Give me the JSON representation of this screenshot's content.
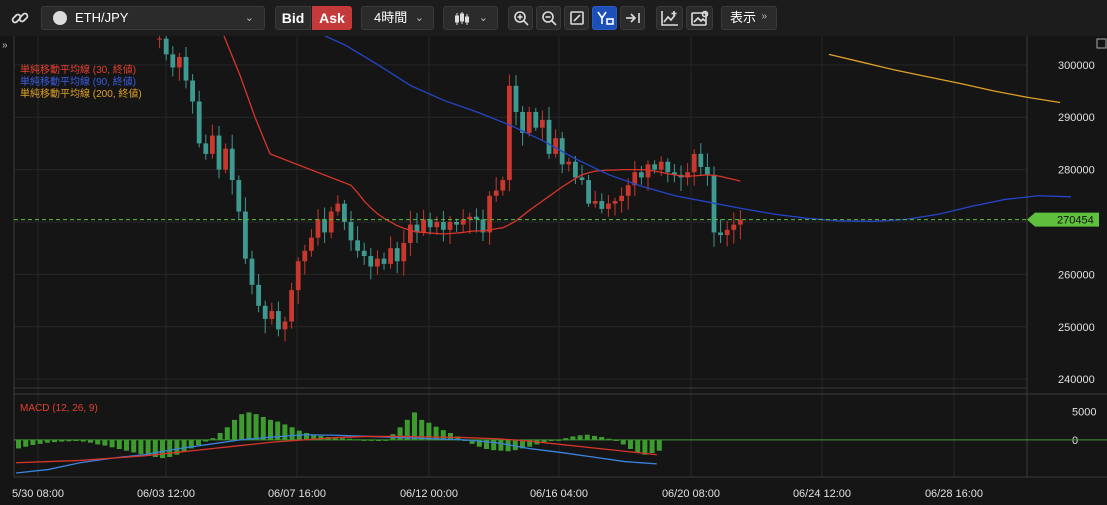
{
  "toolbar": {
    "symbol": "ETH/JPY",
    "bid_label": "Bid",
    "ask_label": "Ask",
    "timeframe": "4時間",
    "display_label": "表示"
  },
  "legend": {
    "ma30": "単純移動平均線 (30, 終値)",
    "ma90": "単純移動平均線 (90, 終値)",
    "ma200": "単純移動平均線 (200, 終値)",
    "macd": "MACD (12, 26, 9)"
  },
  "colors": {
    "up": "#c8382e",
    "down": "#3e9990",
    "ma30": "#d8352a",
    "ma90": "#2545c8",
    "ma200": "#e0a028",
    "macd_line": "#3a84e0",
    "signal_line": "#d8352a",
    "hist": "#3d9b2f",
    "price_tag": "#5ec03c"
  },
  "chart_data": [
    {
      "type": "candlestick",
      "symbol": "ETH/JPY",
      "interval": "4時間",
      "ylim": [
        238500,
        305500
      ],
      "yticks": [
        240000,
        250000,
        260000,
        270000,
        280000,
        290000,
        300000
      ],
      "xtick_labels": [
        "5/30 08:00",
        "06/03 12:00",
        "06/07 16:00",
        "06/12 00:00",
        "06/16 04:00",
        "06/20 08:00",
        "06/24 12:00",
        "06/28 16:00"
      ],
      "current_price": 270454,
      "current_price_label": "270454",
      "closes": [
        305000,
        305000,
        302000,
        299500,
        301500,
        297000,
        293000,
        285000,
        283000,
        286500,
        280000,
        284000,
        278000,
        272000,
        263000,
        258000,
        254000,
        251500,
        253000,
        249500,
        251000,
        257000,
        262500,
        264500,
        267000,
        270500,
        268000,
        272000,
        273500,
        270000,
        266500,
        264500,
        263500,
        261500,
        263000,
        262000,
        265000,
        262500,
        266000,
        269500,
        268000,
        270500,
        269000,
        270000,
        268500,
        270000,
        269500,
        270500,
        271000,
        270500,
        268000,
        275000,
        276000,
        278000,
        296000,
        291000,
        287000,
        291000,
        288000,
        289500,
        283000,
        286000,
        281000,
        281500,
        278500,
        278000,
        273500,
        274000,
        272500,
        273500,
        274000,
        275000,
        277000,
        279500,
        278500,
        281000,
        280000,
        281500,
        279500,
        279000,
        278500,
        279500,
        283000,
        280500,
        279000,
        268000,
        267500,
        268500,
        269500,
        270454
      ],
      "ma30": [
        null,
        null,
        null,
        null,
        null,
        null,
        null,
        null,
        null,
        null,
        null,
        null,
        null,
        null,
        null,
        null,
        null,
        null,
        null,
        null,
        null,
        null,
        null,
        null,
        null,
        null,
        null,
        null,
        null,
        null,
        277000,
        275600,
        274000,
        272700,
        271600,
        270700,
        270000,
        269300,
        268800,
        268400,
        268100,
        268000,
        267900,
        267800,
        267700,
        267800,
        267900,
        268000,
        268200,
        268300,
        268300,
        268500,
        268700,
        268900,
        269500,
        270200,
        271200,
        272200,
        273100,
        274000,
        274900,
        275800,
        276700,
        277500,
        278300,
        279000,
        279400,
        279700,
        279800,
        279900,
        279900,
        280000,
        280000,
        280000,
        280000,
        279900,
        279700,
        279500,
        279200,
        279000,
        278800,
        278700,
        278800,
        278900,
        279000,
        278900,
        278700,
        278400,
        278100,
        277800
      ],
      "ma90": [
        null,
        null,
        null,
        null,
        null,
        null,
        null,
        null,
        null,
        null,
        null,
        null,
        null,
        null,
        null,
        null,
        null,
        null,
        null,
        null,
        null,
        null,
        null,
        null,
        null,
        null,
        null,
        null,
        null,
        null,
        null,
        null,
        null,
        null,
        null,
        null,
        null,
        null,
        null,
        null,
        null,
        null,
        null,
        null,
        null,
        null,
        null,
        null,
        null,
        null,
        null,
        null,
        null,
        null,
        null,
        null,
        null,
        null,
        null,
        null,
        null,
        null,
        null,
        null,
        null,
        null,
        null,
        null,
        null,
        null,
        null,
        null,
        null,
        null,
        null,
        null,
        null,
        null,
        null,
        null,
        null,
        null,
        null,
        null,
        null,
        null,
        null,
        null,
        null,
        null
      ],
      "ma90_approx": [
        [
          37,
          305500
        ],
        [
          40,
          303800
        ],
        [
          45,
          300000
        ],
        [
          50,
          296000
        ],
        [
          55,
          293200
        ],
        [
          60,
          291000
        ],
        [
          65,
          288500
        ],
        [
          70,
          285500
        ],
        [
          75,
          282000
        ],
        [
          80,
          279000
        ],
        [
          85,
          276800
        ],
        [
          90,
          275000
        ],
        [
          95,
          273800
        ],
        [
          100,
          272600
        ],
        [
          105,
          271500
        ],
        [
          110,
          270700
        ],
        [
          115,
          270200
        ],
        [
          120,
          270100
        ],
        [
          125,
          270500
        ],
        [
          130,
          271500
        ],
        [
          135,
          273000
        ],
        [
          140,
          274300
        ],
        [
          145,
          275000
        ],
        [
          150,
          274800
        ]
      ],
      "ma200_approx": [
        [
          115,
          302000
        ],
        [
          120,
          300500
        ],
        [
          125,
          299000
        ],
        [
          130,
          297700
        ],
        [
          135,
          296400
        ],
        [
          140,
          295000
        ],
        [
          145,
          293800
        ],
        [
          150,
          292800
        ]
      ]
    },
    {
      "type": "bar",
      "name": "MACD (12, 26, 9)",
      "ylim": [
        -6500,
        7500
      ],
      "yticks": [
        0,
        5000
      ],
      "histogram": [
        -1500,
        -1200,
        -900,
        -700,
        -500,
        -400,
        -300,
        -250,
        -200,
        -300,
        -500,
        -800,
        -1000,
        -1300,
        -1600,
        -1900,
        -2200,
        -2500,
        -2800,
        -3000,
        -3200,
        -3000,
        -2600,
        -2100,
        -1500,
        -900,
        -300,
        300,
        1200,
        2200,
        3500,
        4500,
        4800,
        4500,
        4000,
        3500,
        3200,
        2700,
        2200,
        1600,
        1200,
        900,
        700,
        500,
        400,
        300,
        200,
        100,
        0,
        -100,
        -200,
        0,
        1000,
        2200,
        3500,
        4800,
        3500,
        3000,
        2300,
        1700,
        1200,
        600,
        -200,
        -700,
        -1200,
        -1600,
        -1800,
        -1900,
        -2000,
        -1800,
        -1500,
        -1200,
        -800,
        -500,
        -200,
        0,
        300,
        600,
        800,
        900,
        700,
        500,
        200,
        -200,
        -800,
        -1600,
        -2200,
        -2600,
        -2300,
        -1900
      ],
      "macd_line_approx": [
        [
          -5.8
        ],
        [
          -5.2
        ],
        [
          -4.0
        ],
        [
          -3.2
        ],
        [
          -2.6
        ],
        [
          -1.6
        ],
        [
          -0.8
        ],
        [
          0.0
        ],
        [
          0.5
        ],
        [
          0.9
        ],
        [
          0.8
        ],
        [
          0.6
        ],
        [
          0.4
        ],
        [
          0.2
        ],
        [
          0.0
        ],
        [
          -0.5
        ],
        [
          -1.5
        ],
        [
          -2.2
        ],
        [
          -3.0
        ],
        [
          -3.8
        ],
        [
          -4.2
        ]
      ],
      "signal_line_approx": [
        [
          -4.0
        ],
        [
          -3.8
        ],
        [
          -3.6
        ],
        [
          -3.2
        ],
        [
          -2.8
        ],
        [
          -2.2
        ],
        [
          -1.6
        ],
        [
          -1.0
        ],
        [
          -0.4
        ],
        [
          0.0
        ],
        [
          0.4
        ],
        [
          0.6
        ],
        [
          0.6
        ],
        [
          0.5
        ],
        [
          0.4
        ],
        [
          0.2
        ],
        [
          -0.2
        ],
        [
          -0.8
        ],
        [
          -1.4
        ],
        [
          -2.0
        ],
        [
          -2.6
        ]
      ]
    }
  ]
}
